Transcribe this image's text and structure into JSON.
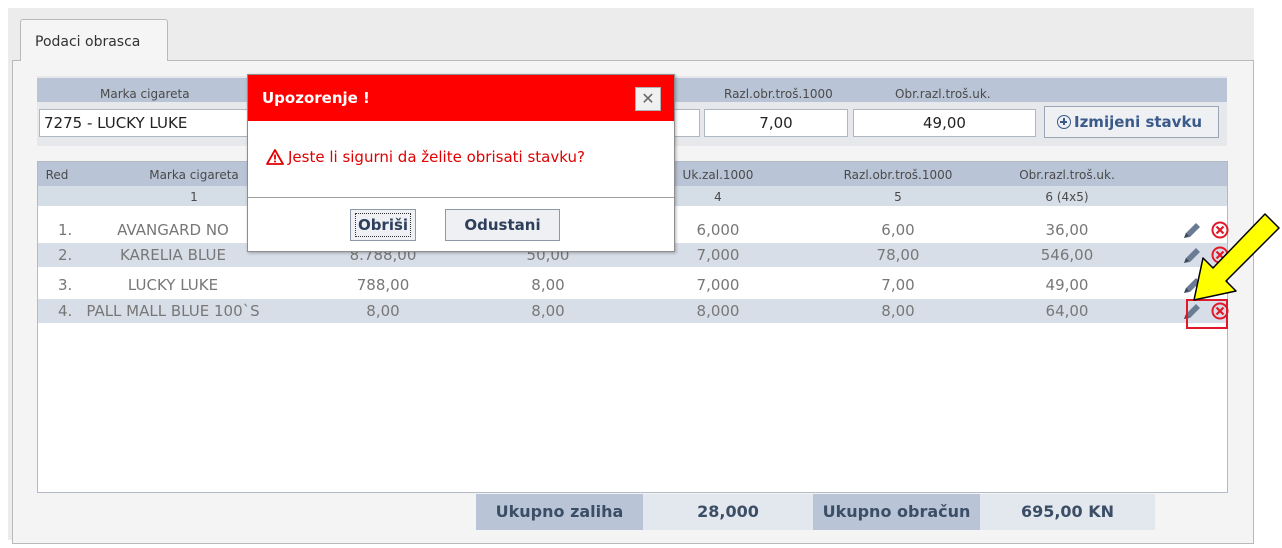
{
  "tab": {
    "label": "Podaci obrasca"
  },
  "edit_form": {
    "headers": {
      "marka": "Marka cigareta",
      "razl": "Razl.obr.troš.1000",
      "obr": "Obr.razl.troš.uk."
    },
    "marka_value": "7275 - LUCKY LUKE",
    "razl_value": "7,00",
    "obr_value": "49,00",
    "update_button": "Izmijeni stavku"
  },
  "grid": {
    "headers": [
      "Red",
      "Marka cigareta",
      "Uk.zal.1000",
      "Razl.obr.troš.1000",
      "Obr.razl.troš.uk."
    ],
    "subheaders": [
      "1",
      "4",
      "5",
      "6 (4x5)"
    ],
    "rows": [
      {
        "red": "1.",
        "marka": "AVANGARD NO",
        "c2": "",
        "c3": "",
        "c4": "6,000",
        "c5": "6,00",
        "c6": "36,00"
      },
      {
        "red": "2.",
        "marka": "KARELIA BLUE",
        "c2": "8.788,00",
        "c3": "50,00",
        "c4": "7,000",
        "c5": "78,00",
        "c6": "546,00"
      },
      {
        "red": "3.",
        "marka": "LUCKY LUKE",
        "c2": "788,00",
        "c3": "8,00",
        "c4": "7,000",
        "c5": "7,00",
        "c6": "49,00"
      },
      {
        "red": "4.",
        "marka": "PALL MALL BLUE 100`S",
        "c2": "8,00",
        "c3": "8,00",
        "c4": "8,000",
        "c5": "8,00",
        "c6": "64,00"
      }
    ]
  },
  "footer": {
    "zaliha_label": "Ukupno zaliha",
    "zaliha_value": "28,000",
    "obracun_label": "Ukupno obračun",
    "obracun_value": "695,00 KN"
  },
  "dialog": {
    "title": "Upozorenje !",
    "message": "Jeste li sigurni da želite obrisati stavku?",
    "confirm_button": "Obriši",
    "cancel_button": "Odustani"
  },
  "colors": {
    "dialog_title": "#ff0000",
    "header_bg": "#b9c5d6",
    "alt_row": "#d8dee8",
    "highlight_border": "#e0192a",
    "arrow": "#ffff00"
  }
}
